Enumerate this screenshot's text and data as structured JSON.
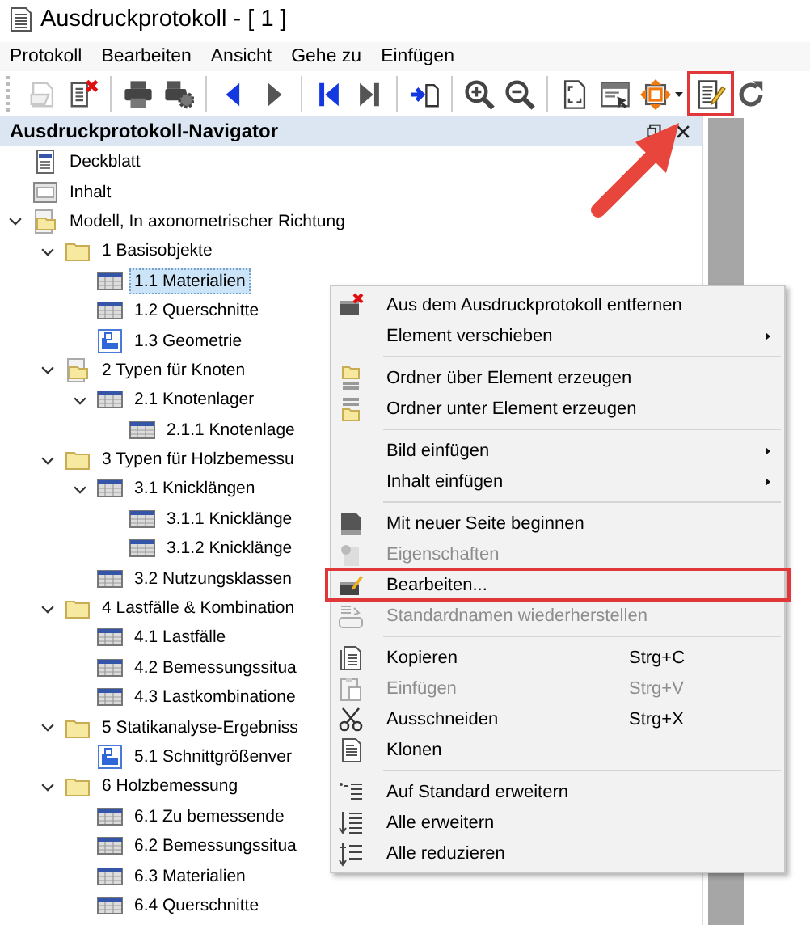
{
  "window": {
    "title": "Ausdruckprotokoll - [ 1 ]"
  },
  "menu_bar": [
    "Protokoll",
    "Bearbeiten",
    "Ansicht",
    "Gehe zu",
    "Einfügen"
  ],
  "toolbar": [
    [
      {
        "disabled": true,
        "marked": false,
        "dropdown": false
      },
      {
        "disabled": false,
        "marked": false,
        "dropdown": false
      }
    ],
    [
      {
        "disabled": false,
        "marked": false,
        "dropdown": false
      },
      {
        "disabled": false,
        "marked": false,
        "dropdown": false
      }
    ],
    [
      {
        "disabled": false,
        "marked": false,
        "dropdown": false
      },
      {
        "disabled": true,
        "marked": false,
        "dropdown": false
      }
    ],
    [
      {
        "disabled": false,
        "marked": false,
        "dropdown": false
      },
      {
        "disabled": true,
        "marked": false,
        "dropdown": false
      }
    ],
    [
      {
        "disabled": false,
        "marked": false,
        "dropdown": false
      }
    ],
    [
      {
        "disabled": false,
        "marked": false,
        "dropdown": false
      },
      {
        "disabled": false,
        "marked": false,
        "dropdown": false
      }
    ],
    [
      {
        "disabled": false,
        "marked": false,
        "dropdown": false
      },
      {
        "disabled": false,
        "marked": false,
        "dropdown": false
      },
      {
        "disabled": false,
        "marked": false,
        "dropdown": true
      },
      {
        "disabled": false,
        "marked": true,
        "dropdown": false
      },
      {
        "disabled": false,
        "marked": false,
        "dropdown": false
      }
    ]
  ],
  "navigator": {
    "title": "Ausdruckprotokoll-Navigator",
    "tree": [
      {
        "label": "Deckblatt",
        "kind": "cover",
        "selected": false
      },
      {
        "label": "Inhalt",
        "kind": "contents",
        "selected": false
      },
      {
        "label": "Modell, In axonometrischer Richtung",
        "kind": "folder-doc",
        "selected": false,
        "expanded": true,
        "children": [
          {
            "label": "1 Basisobjekte",
            "kind": "folder",
            "selected": false,
            "expanded": true,
            "children": [
              {
                "label": "1.1 Materialien",
                "kind": "table",
                "selected": true
              },
              {
                "label": "1.2 Querschnitte",
                "kind": "table",
                "selected": false
              },
              {
                "label": "1.3 Geometrie",
                "kind": "image",
                "selected": false
              }
            ]
          },
          {
            "label": "2 Typen für Knoten",
            "kind": "folder-doc",
            "selected": false,
            "expanded": true,
            "children": [
              {
                "label": "2.1 Knotenlager",
                "kind": "table",
                "selected": false,
                "expanded": true,
                "children": [
                  {
                    "label": "2.1.1 Knotenlage",
                    "kind": "table",
                    "selected": false
                  }
                ]
              }
            ]
          },
          {
            "label": "3 Typen für Holzbemessu",
            "kind": "folder",
            "selected": false,
            "expanded": true,
            "children": [
              {
                "label": "3.1 Knicklängen",
                "kind": "table",
                "selected": false,
                "expanded": true,
                "children": [
                  {
                    "label": "3.1.1 Knicklänge",
                    "kind": "table",
                    "selected": false
                  },
                  {
                    "label": "3.1.2 Knicklänge",
                    "kind": "table",
                    "selected": false
                  }
                ]
              },
              {
                "label": "3.2 Nutzungsklassen",
                "kind": "table",
                "selected": false
              }
            ]
          },
          {
            "label": "4 Lastfälle & Kombination",
            "kind": "folder",
            "selected": false,
            "expanded": true,
            "children": [
              {
                "label": "4.1 Lastfälle",
                "kind": "table",
                "selected": false
              },
              {
                "label": "4.2 Bemessungssitua",
                "kind": "table",
                "selected": false
              },
              {
                "label": "4.3 Lastkombinatione",
                "kind": "table",
                "selected": false
              }
            ]
          },
          {
            "label": "5 Statikanalyse-Ergebniss",
            "kind": "folder",
            "selected": false,
            "expanded": true,
            "children": [
              {
                "label": "5.1 Schnittgrößenver",
                "kind": "image",
                "selected": false
              }
            ]
          },
          {
            "label": "6 Holzbemessung",
            "kind": "folder",
            "selected": false,
            "expanded": true,
            "children": [
              {
                "label": "6.1 Zu bemessende",
                "kind": "table",
                "selected": false
              },
              {
                "label": "6.2 Bemessungssitua",
                "kind": "table",
                "selected": false
              },
              {
                "label": "6.3 Materialien",
                "kind": "table",
                "selected": false
              },
              {
                "label": "6.4 Querschnitte",
                "kind": "table",
                "selected": false
              }
            ]
          }
        ]
      }
    ]
  },
  "context_menu": [
    [
      {
        "label": "Aus dem Ausdruckprotokoll entfernen",
        "disabled": false,
        "submenu": false,
        "marked": false
      },
      {
        "label": "Element verschieben",
        "disabled": false,
        "submenu": true,
        "marked": false
      }
    ],
    [
      {
        "label": "Ordner über Element erzeugen",
        "disabled": false,
        "submenu": false,
        "marked": false
      },
      {
        "label": "Ordner unter Element erzeugen",
        "disabled": false,
        "submenu": false,
        "marked": false
      }
    ],
    [
      {
        "label": "Bild einfügen",
        "disabled": false,
        "submenu": true,
        "marked": false
      },
      {
        "label": "Inhalt einfügen",
        "disabled": false,
        "submenu": true,
        "marked": false
      }
    ],
    [
      {
        "label": "Mit neuer Seite beginnen",
        "disabled": false,
        "submenu": false,
        "marked": false
      },
      {
        "label": "Eigenschaften",
        "disabled": true,
        "submenu": false,
        "marked": false
      },
      {
        "label": "Bearbeiten...",
        "disabled": false,
        "submenu": false,
        "marked": true
      },
      {
        "label": "Standardnamen wiederherstellen",
        "disabled": true,
        "submenu": false,
        "marked": false
      }
    ],
    [
      {
        "label": "Kopieren",
        "shortcut": "Strg+C",
        "disabled": false,
        "submenu": false,
        "marked": false
      },
      {
        "label": "Einfügen",
        "shortcut": "Strg+V",
        "disabled": true,
        "submenu": false,
        "marked": false
      },
      {
        "label": "Ausschneiden",
        "shortcut": "Strg+X",
        "disabled": false,
        "submenu": false,
        "marked": false
      },
      {
        "label": "Klonen",
        "disabled": false,
        "submenu": false,
        "marked": false
      }
    ],
    [
      {
        "label": "Auf Standard erweitern",
        "disabled": false,
        "submenu": false,
        "marked": false
      },
      {
        "label": "Alle erweitern",
        "disabled": false,
        "submenu": false,
        "marked": false
      },
      {
        "label": "Alle reduzieren",
        "disabled": false,
        "submenu": false,
        "marked": false
      }
    ]
  ]
}
